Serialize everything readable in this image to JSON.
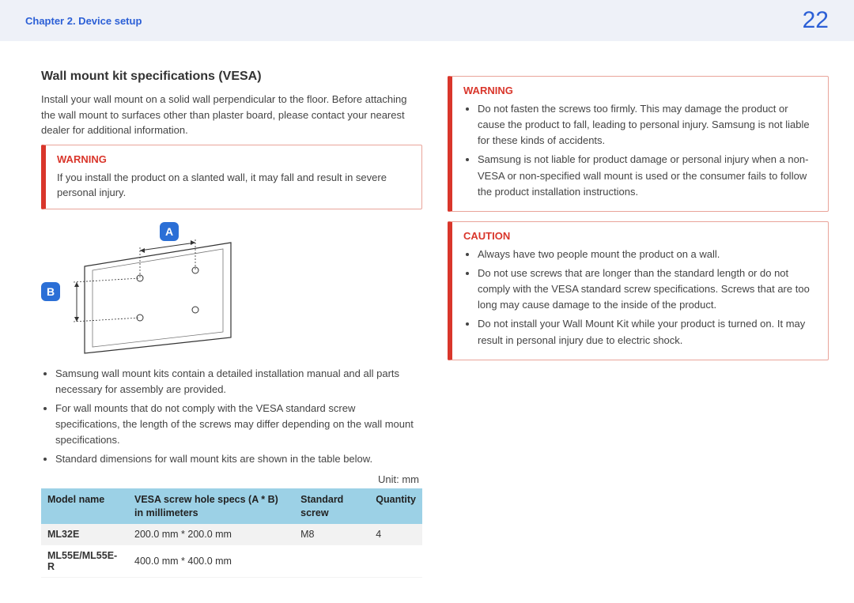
{
  "header": {
    "chapter": "Chapter 2. Device setup",
    "page_number": "22"
  },
  "left": {
    "heading": "Wall mount kit specifications (VESA)",
    "intro": "Install your wall mount on a solid wall perpendicular to the floor. Before attaching the wall mount to surfaces other than plaster board, please contact your nearest dealer for additional information.",
    "warning1": {
      "title": "WARNING",
      "text": "If you install the product on a slanted wall, it may fall and result in severe personal injury."
    },
    "markers": {
      "a": "A",
      "b": "B"
    },
    "bullets": [
      "Samsung wall mount kits contain a detailed installation manual and all parts necessary for assembly are provided.",
      "For wall mounts that do not comply with the VESA standard screw specifications, the length of the screws may differ depending on the wall mount specifications.",
      "Standard dimensions for wall mount kits are shown in the table below."
    ],
    "unit": "Unit: mm",
    "table": {
      "headers": {
        "model": "Model name",
        "vesa": "VESA screw hole specs (A * B) in millimeters",
        "screw": "Standard screw",
        "qty": "Quantity"
      },
      "rows": [
        {
          "model": "ML32E",
          "vesa": "200.0 mm * 200.0 mm",
          "screw": "M8",
          "qty": "4"
        },
        {
          "model": "ML55E/ML55E-R",
          "vesa": "400.0 mm * 400.0 mm",
          "screw": "",
          "qty": ""
        }
      ]
    }
  },
  "right": {
    "warning2": {
      "title": "WARNING",
      "items": [
        "Do not fasten the screws too firmly. This may damage the product or cause the product to fall, leading to personal injury. Samsung is not liable for these kinds of accidents.",
        "Samsung is not liable for product damage or personal injury when a non-VESA or non-specified wall mount is used or the consumer fails to follow the product installation instructions."
      ]
    },
    "caution": {
      "title": "CAUTION",
      "items": [
        "Always have two people mount the product on a wall.",
        "Do not use screws that are longer than the standard length or do not comply with the VESA standard screw specifications. Screws that are too long may cause damage to the inside of the product.",
        "Do not install your Wall Mount Kit while your product is turned on. It may result in personal injury due to electric shock."
      ]
    }
  }
}
